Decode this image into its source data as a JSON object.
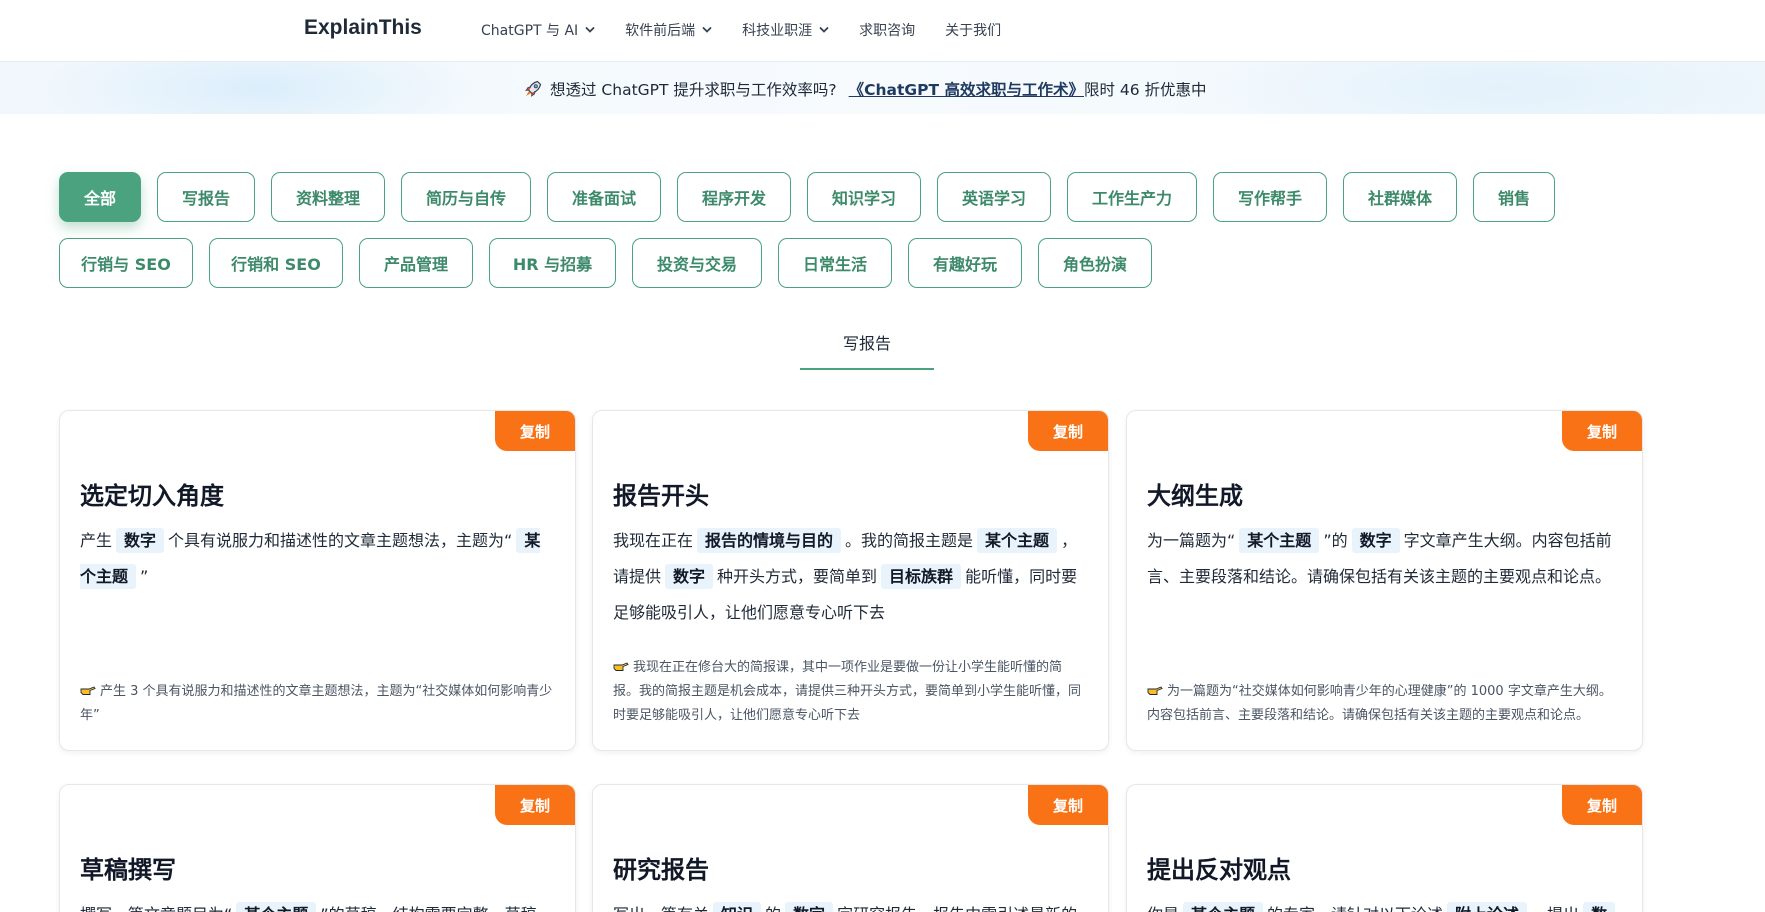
{
  "header": {
    "logo": "ExplainThis",
    "nav": [
      {
        "label": "ChatGPT 与 AI",
        "has_dropdown": true
      },
      {
        "label": "软件前后端",
        "has_dropdown": true
      },
      {
        "label": "科技业职涯",
        "has_dropdown": true
      },
      {
        "label": "求职咨询",
        "has_dropdown": false
      },
      {
        "label": "关于我们",
        "has_dropdown": false
      }
    ]
  },
  "banner": {
    "icon": "rocket-icon",
    "text": "想透过 ChatGPT 提升求职与工作效率吗?",
    "link": "《ChatGPT 高效求职与工作术》",
    "suffix": "限时 46 折优惠中"
  },
  "categories": [
    "全部",
    "写报告",
    "资料整理",
    "简历与自传",
    "准备面试",
    "程序开发",
    "知识学习",
    "英语学习",
    "工作生产力",
    "写作帮手",
    "社群媒体",
    "销售",
    "行销与 SEO",
    "行销和 SEO",
    "产品管理",
    "HR 与招募",
    "投资与交易",
    "日常生活",
    "有趣好玩",
    "角色扮演"
  ],
  "active_category": "全部",
  "section_title": "写报告",
  "copy_label": "复制",
  "cards": [
    {
      "title": "选定切入角度",
      "body": [
        "产生",
        {
          "tag": "数字"
        },
        "个具有说服力和描述性的文章主题想法，主题为“",
        {
          "tag": "某个主题"
        },
        "”"
      ],
      "example": "产生 3 个具有说服力和描述性的文章主题想法，主题为“社交媒体如何影响青少年”"
    },
    {
      "title": "报告开头",
      "body": [
        "我现在正在",
        {
          "tag": "报告的情境与目的"
        },
        "。我的简报主题是",
        {
          "tag": "某个主题"
        },
        "，请提供",
        {
          "tag": "数字"
        },
        "种开头方式，要简单到",
        {
          "tag": "目标族群"
        },
        "能听懂，同时要足够能吸引人，让他们愿意专心听下去"
      ],
      "example": "我现在正在修台大的简报课，其中一项作业是要做一份让小学生能听懂的简报。我的简报主题是机会成本，请提供三种开头方式，要简单到小学生能听懂，同时要足够能吸引人，让他们愿意专心听下去"
    },
    {
      "title": "大纲生成",
      "body": [
        "为一篇题为“",
        {
          "tag": "某个主题"
        },
        "”的",
        {
          "tag": "数字"
        },
        "字文章产生大纲。内容包括前言、主要段落和结论。请确保包括有关该主题的主要观点和论点。"
      ],
      "example": "为一篇题为“社交媒体如何影响青少年的心理健康”的 1000 字文章产生大纲。内容包括前言、主要段落和结论。请确保包括有关该主题的主要观点和论点。"
    },
    {
      "title": "草稿撰写",
      "body": [
        "撰写一篇文章题目为“",
        {
          "tag": "某个主题"
        },
        "”的草稿，结构需要完整，草稿"
      ],
      "example": ""
    },
    {
      "title": "研究报告",
      "body": [
        "写出一篇有关",
        {
          "tag": "知识"
        },
        "的",
        {
          "tag": "数字"
        },
        "字研究报告，报告中需引述最新的"
      ],
      "example": ""
    },
    {
      "title": "提出反对观点",
      "body": [
        "你是",
        {
          "tag": "某个主题"
        },
        "的专家，请针对以下论述",
        {
          "tag": "附上论述"
        },
        "，提出",
        {
          "tag": "数"
        }
      ],
      "example": ""
    }
  ]
}
